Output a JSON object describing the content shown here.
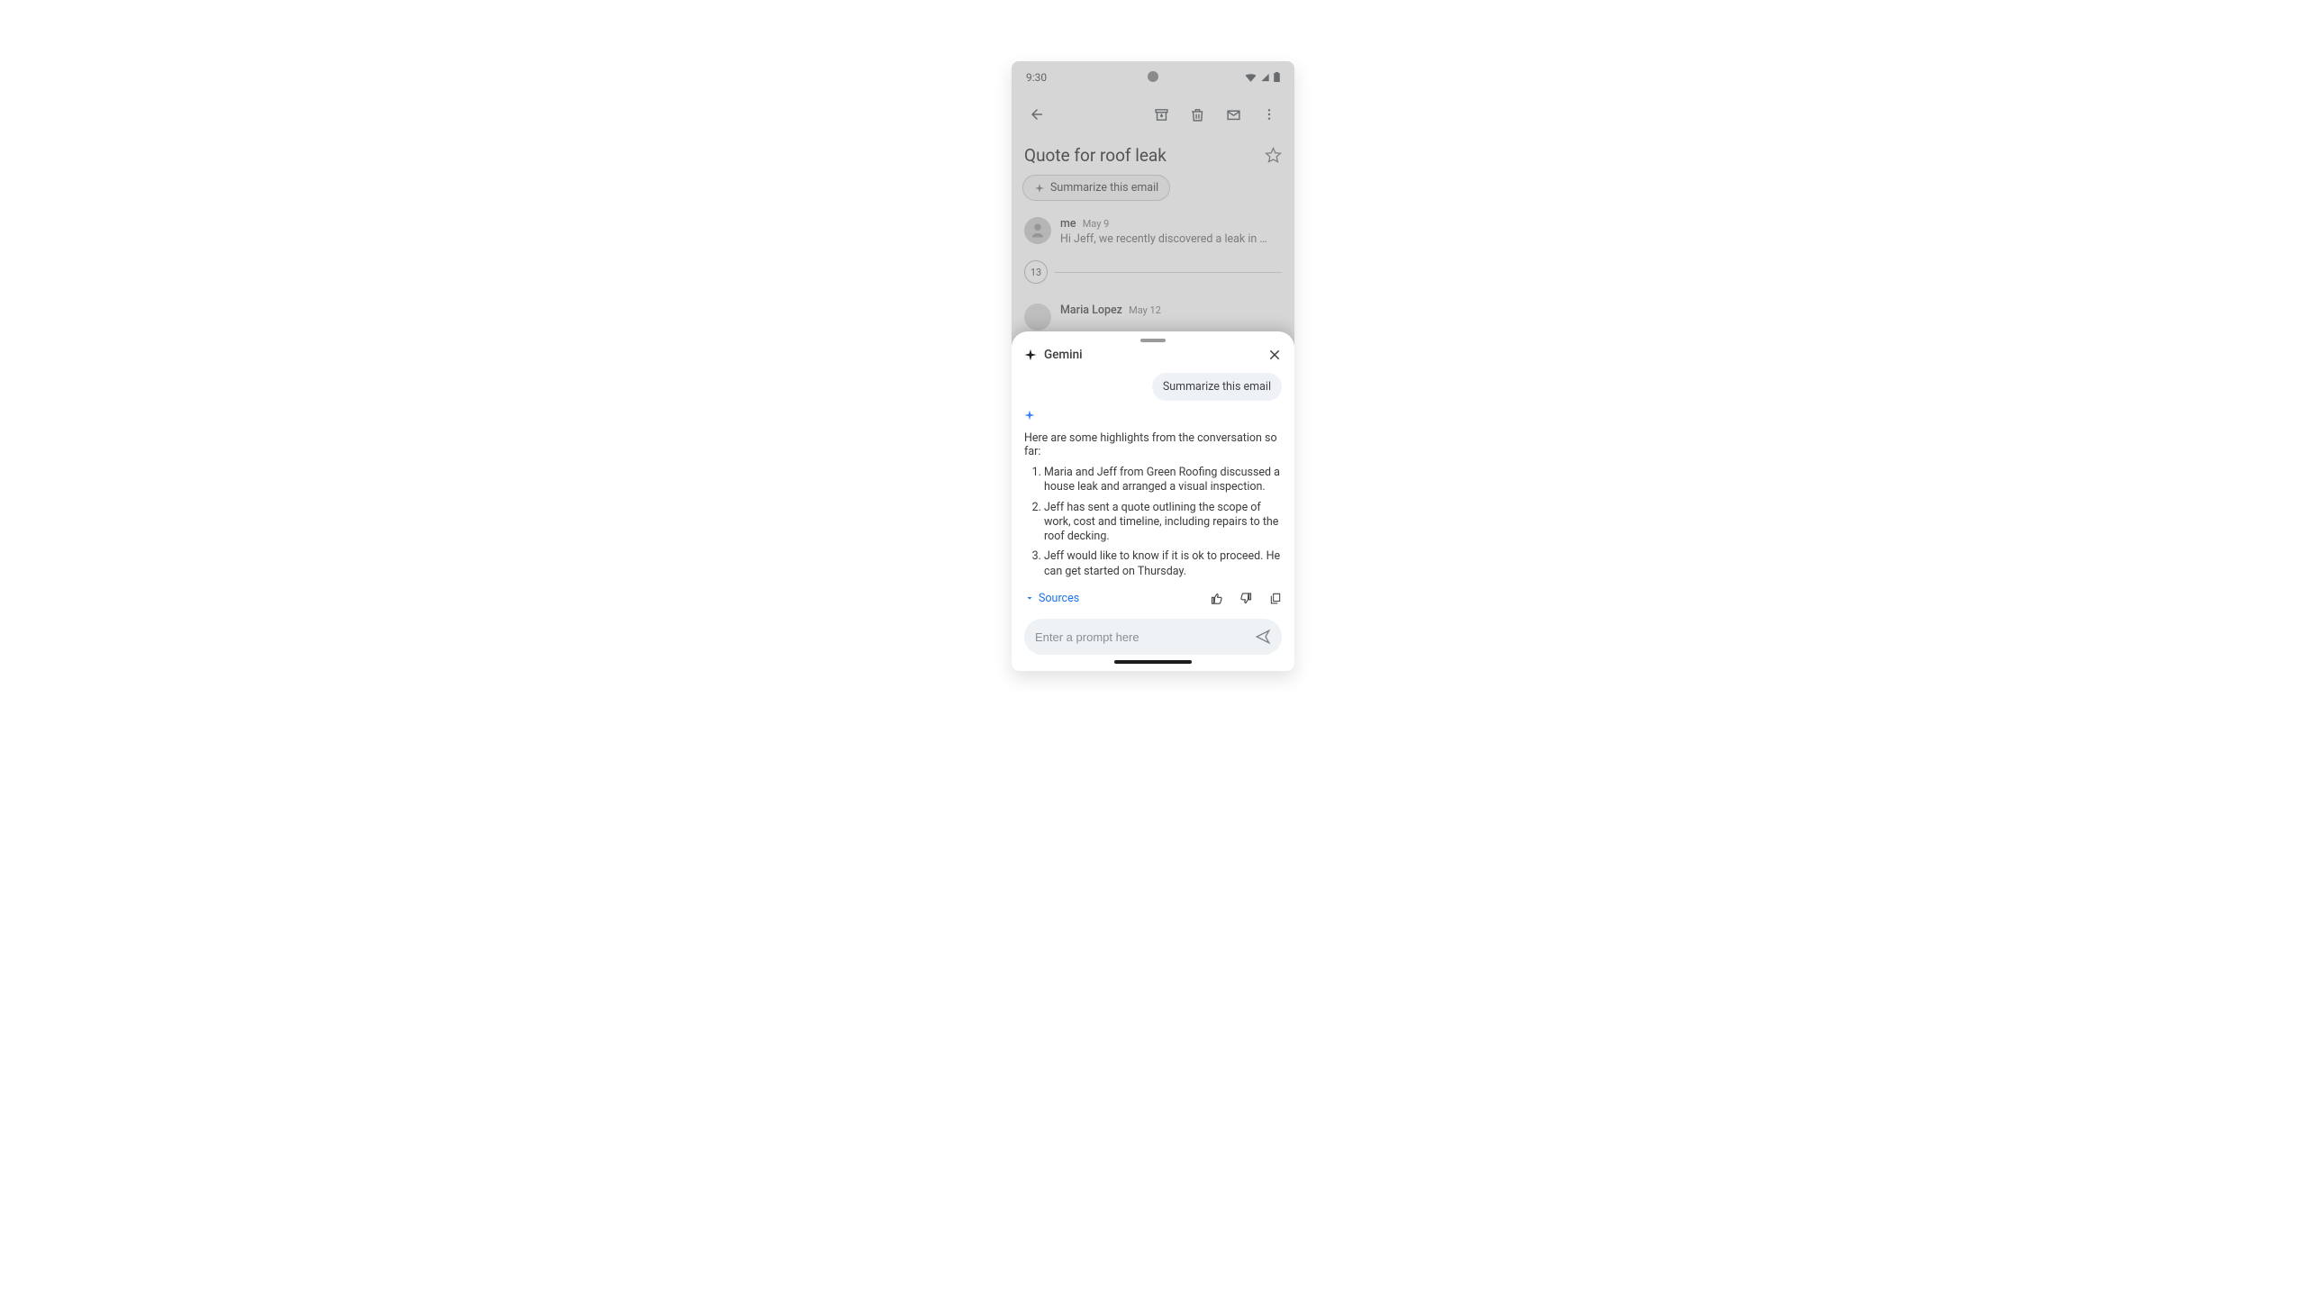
{
  "status_bar": {
    "time": "9:30"
  },
  "gmail": {
    "subject": "Quote for roof leak",
    "summarize_chip_label": "Summarize this email",
    "messages": [
      {
        "sender": "me",
        "date": "May 9",
        "preview": "Hi Jeff, we recently discovered a leak in our roof..."
      },
      {
        "sender": "Maria Lopez",
        "date": "May 12",
        "preview": ""
      }
    ],
    "collapsed_count": "13"
  },
  "gemini": {
    "title": "Gemini",
    "user_prompt": "Summarize this email",
    "intro": "Here are some highlights from the conversation so far:",
    "summary": [
      "Maria and Jeff from Green Roofing discussed a house leak and arranged a visual inspection.",
      "Jeff has sent a quote outlining the scope of work, cost and timeline, including repairs to the roof decking.",
      "Jeff would like to know if it is ok to proceed. He can get started on Thursday."
    ],
    "sources_label": "Sources",
    "prompt_placeholder": "Enter a prompt here"
  }
}
